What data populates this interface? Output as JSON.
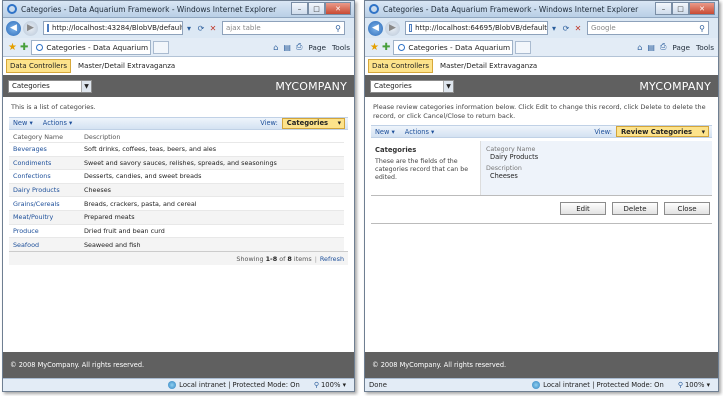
{
  "left": {
    "title": "Categories - Data Aquarium Framework - Windows Internet Explorer",
    "address": "http://localhost:43284/BlobVB/default",
    "search_text": "ajax table",
    "tab_label": "Categories - Data Aquarium Framew...",
    "menu": [
      "Data Controllers",
      "Master/Detail Extravaganza"
    ],
    "controller_select": "Categories",
    "company": "MYCOMPANY",
    "description": "This is a list of categories.",
    "toolbar": {
      "new": "New",
      "actions": "Actions",
      "view_label": "View:",
      "view_value": "Categories"
    },
    "grid": {
      "headers": [
        "Category Name",
        "Description"
      ],
      "rows": [
        [
          "Beverages",
          "Soft drinks, coffees, teas, beers, and ales"
        ],
        [
          "Condiments",
          "Sweet and savory sauces, relishes, spreads, and seasonings"
        ],
        [
          "Confections",
          "Desserts, candies, and sweet breads"
        ],
        [
          "Dairy Products",
          "Cheeses"
        ],
        [
          "Grains/Cereals",
          "Breads, crackers, pasta, and cereal"
        ],
        [
          "Meat/Poultry",
          "Prepared meats"
        ],
        [
          "Produce",
          "Dried fruit and bean curd"
        ],
        [
          "Seafood",
          "Seaweed and fish"
        ]
      ]
    },
    "pager": {
      "showing": "Showing",
      "range": "1-8",
      "of": "of",
      "total": "8",
      "items": "items",
      "refresh": "Refresh"
    },
    "footer": "© 2008 MyCompany. All rights reserved.",
    "status": {
      "text": "",
      "zone": "Local intranet | Protected Mode: On",
      "zoom": "100%"
    }
  },
  "right": {
    "title": "Categories - Data Aquarium Framework - Windows Internet Explorer",
    "address": "http://localhost:64695/BlobVB/default",
    "search_text": "Google",
    "tab_label": "Categories - Data Aquarium Framew...",
    "menu": [
      "Data Controllers",
      "Master/Detail Extravaganza"
    ],
    "controller_select": "Categories",
    "company": "MYCOMPANY",
    "description": "Please review categories information below. Click Edit to change this record, click Delete to delete the record, or click Cancel/Close to return back.",
    "toolbar": {
      "new": "New",
      "actions": "Actions",
      "view_label": "View:",
      "view_value": "Review Categories"
    },
    "form": {
      "category_title": "Categories",
      "category_desc": "These are the fields of the categories record that can be edited.",
      "fields": [
        {
          "label": "Category Name",
          "value": "Dairy Products"
        },
        {
          "label": "Description",
          "value": "Cheeses"
        }
      ]
    },
    "buttons": {
      "edit": "Edit",
      "delete": "Delete",
      "close": "Close"
    },
    "footer": "© 2008 MyCompany. All rights reserved.",
    "status": {
      "text": "Done",
      "zone": "Local intranet | Protected Mode: On",
      "zoom": "100%"
    }
  },
  "browser": {
    "page_label": "Page",
    "tools_label": "Tools"
  }
}
